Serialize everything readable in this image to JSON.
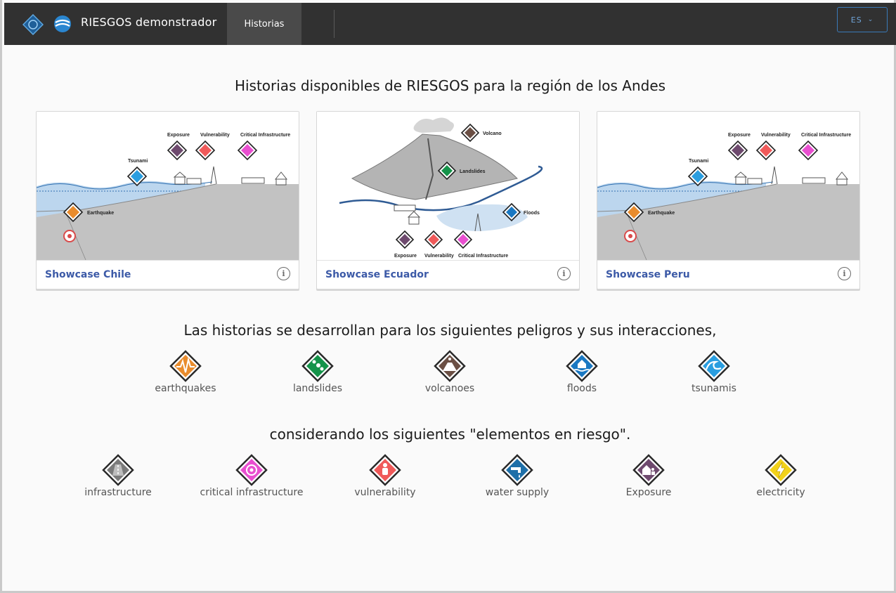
{
  "header": {
    "app_title": "RIESGOS demonstrador",
    "nav_tab": "Historias",
    "language": "ES"
  },
  "showcases": {
    "heading": "Historias disponibles de RIESGOS para la región de los Andes",
    "cards": [
      {
        "title": "Showcase Chile"
      },
      {
        "title": "Showcase Ecuador"
      },
      {
        "title": "Showcase Peru"
      }
    ],
    "diagram_labels": {
      "exposure": "Exposure",
      "vulnerability": "Vulnerability",
      "critical_infrastructure": "Critical Infrastructure",
      "tsunami": "Tsunami",
      "earthquake": "Earthquake",
      "volcano": "Volcano",
      "landslides": "Landslides",
      "floods": "Floods"
    }
  },
  "hazards": {
    "heading": "Las historias se desarrollan para los siguientes peligros y sus interacciones,",
    "items": [
      {
        "label": "earthquakes",
        "icon": "earthquake-icon",
        "color": "#e98c2d"
      },
      {
        "label": "landslides",
        "icon": "landslide-icon",
        "color": "#15934a"
      },
      {
        "label": "volcanoes",
        "icon": "volcano-icon",
        "color": "#6b4f44"
      },
      {
        "label": "floods",
        "icon": "flood-icon",
        "color": "#1a78c2"
      },
      {
        "label": "tsunamis",
        "icon": "tsunami-icon",
        "color": "#2a9ee0"
      }
    ]
  },
  "elements_at_risk": {
    "heading": "considerando los siguientes \"elementos en riesgo\".",
    "items": [
      {
        "label": "infrastructure",
        "icon": "road-icon",
        "color": "#7a7a7a"
      },
      {
        "label": "critical infrastructure",
        "icon": "critical-infrastructure-icon",
        "color": "#e94fd0"
      },
      {
        "label": "vulnerability",
        "icon": "vulnerability-icon",
        "color": "#f05a5a"
      },
      {
        "label": "water supply",
        "icon": "water-tap-icon",
        "color": "#1e6fa8"
      },
      {
        "label": "Exposure",
        "icon": "exposure-icon",
        "color": "#6e4a6e"
      },
      {
        "label": "electricity",
        "icon": "electricity-icon",
        "color": "#f2d21a"
      }
    ]
  }
}
